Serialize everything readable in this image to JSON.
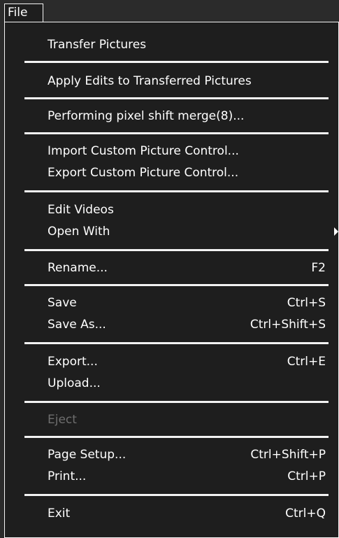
{
  "menubar": {
    "file_label": "File"
  },
  "menu": {
    "transfer_pictures": "Transfer Pictures",
    "apply_edits": "Apply Edits to Transferred Pictures",
    "pixel_shift_merge": "Performing pixel shift merge(8)...",
    "import_custom": "Import Custom Picture Control...",
    "export_custom": "Export Custom Picture Control...",
    "edit_videos": "Edit Videos",
    "open_with": "Open With",
    "rename": {
      "label": "Rename...",
      "shortcut": "F2"
    },
    "save": {
      "label": "Save",
      "shortcut": "Ctrl+S"
    },
    "save_as": {
      "label": "Save As...",
      "shortcut": "Ctrl+Shift+S"
    },
    "export": {
      "label": "Export...",
      "shortcut": "Ctrl+E"
    },
    "upload": "Upload...",
    "eject": "Eject",
    "page_setup": {
      "label": "Page Setup...",
      "shortcut": "Ctrl+Shift+P"
    },
    "print": {
      "label": "Print...",
      "shortcut": "Ctrl+P"
    },
    "exit": {
      "label": "Exit",
      "shortcut": "Ctrl+Q"
    }
  },
  "colors": {
    "menu_background": "#1e1e1e",
    "text": "#ffffff",
    "disabled_text": "#6e6e6e",
    "separator": "#f2f2f2"
  }
}
